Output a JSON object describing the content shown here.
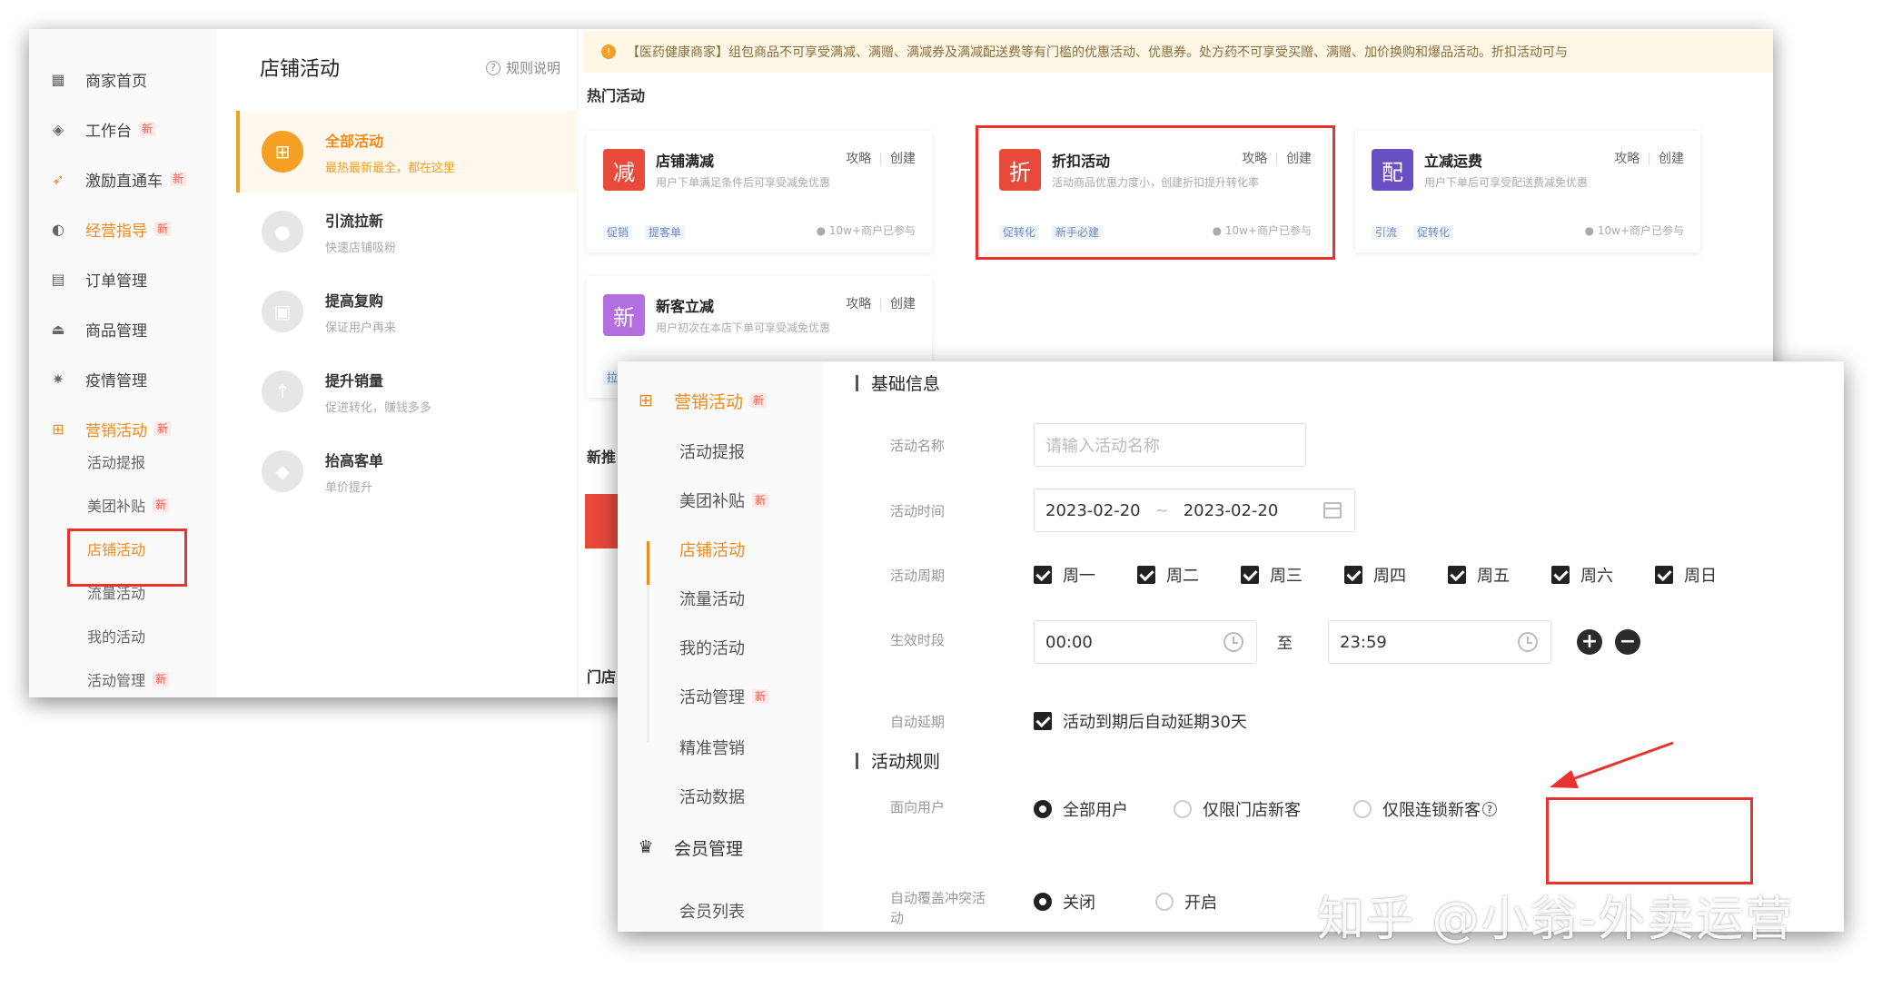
{
  "nav": {
    "items": [
      {
        "label": "商家首页",
        "icon": "grid-icon",
        "new": ""
      },
      {
        "label": "工作台",
        "icon": "cube-icon",
        "new": "新"
      },
      {
        "label": "激励直通车",
        "icon": "rocket-icon",
        "new": "新"
      },
      {
        "label": "经营指导",
        "icon": "pie-chart-icon",
        "new": "新"
      },
      {
        "label": "订单管理",
        "icon": "order-icon",
        "new": ""
      },
      {
        "label": "商品管理",
        "icon": "product-icon",
        "new": ""
      },
      {
        "label": "疫情管理",
        "icon": "virus-icon",
        "new": ""
      },
      {
        "label": "营销活动",
        "icon": "gift-icon",
        "new": "新"
      }
    ],
    "sub": [
      {
        "label": "活动提报",
        "new": ""
      },
      {
        "label": "美团补贴",
        "new": "新"
      },
      {
        "label": "店铺活动",
        "new": ""
      },
      {
        "label": "流量活动",
        "new": ""
      },
      {
        "label": "我的活动",
        "new": ""
      },
      {
        "label": "活动管理",
        "new": "新"
      }
    ]
  },
  "activities": {
    "title": "店铺活动",
    "rules": "规则说明",
    "categories": [
      {
        "title": "全部活动",
        "desc": "最热最新最全，都在这里"
      },
      {
        "title": "引流拉新",
        "desc": "快速店铺吸粉"
      },
      {
        "title": "提高复购",
        "desc": "保证用户再来"
      },
      {
        "title": "提升销量",
        "desc": "促进转化，赚钱多多"
      },
      {
        "title": "抬高客单",
        "desc": "单价提升"
      }
    ]
  },
  "notice": "【医药健康商家】组包商品不可享受满减、满赠、满减券及满减配送费等有门槛的优惠活动、优惠券。处方药不可享受买赠、满赠、加价换购和爆品活动。折扣活动可与",
  "hot": {
    "label": "热门活动",
    "new_label": "新推",
    "store_label": "门店",
    "guide": "攻略",
    "create": "创建",
    "cards": [
      {
        "icon_text": "减",
        "color": "#e84a3c",
        "name": "店铺满减",
        "desc": "用户下单满足条件后可享受减免优惠",
        "tags": [
          "促销",
          "提客单"
        ],
        "joined": "10w+商户已参与"
      },
      {
        "icon_text": "折",
        "color": "#e84a3c",
        "name": "折扣活动",
        "desc": "活动商品优惠力度小，创建折扣提升转化率",
        "tags": [
          "促转化",
          "新手必建"
        ],
        "joined": "10w+商户已参与"
      },
      {
        "icon_text": "配",
        "color": "#6a4fc2",
        "name": "立减运费",
        "desc": "用户下单后可享受配送费减免优惠",
        "tags": [
          "引流",
          "促转化"
        ],
        "joined": "10w+商户已参与"
      },
      {
        "icon_text": "新",
        "color": "#b36ee0",
        "name": "新客立减",
        "desc": "用户初次在本店下单可享受减免优惠",
        "tags": [
          "拉"
        ],
        "joined": ""
      }
    ]
  },
  "front_nav": {
    "groups": [
      {
        "label": "营销活动",
        "new": "新",
        "icon": "gift-icon"
      },
      {
        "label": "会员管理",
        "new": "",
        "icon": "crown-icon"
      }
    ],
    "subs": [
      {
        "label": "活动提报",
        "new": ""
      },
      {
        "label": "美团补贴",
        "new": "新"
      },
      {
        "label": "店铺活动",
        "new": ""
      },
      {
        "label": "流量活动",
        "new": ""
      },
      {
        "label": "我的活动",
        "new": ""
      },
      {
        "label": "活动管理",
        "new": "新"
      },
      {
        "label": "精准营销",
        "new": ""
      },
      {
        "label": "活动数据",
        "new": ""
      },
      {
        "label": "会员列表",
        "new": ""
      }
    ]
  },
  "form": {
    "basic_title": "基础信息",
    "name_label": "活动名称",
    "name_placeholder": "请输入活动名称",
    "time_label": "活动时间",
    "date_start": "2023-02-20",
    "date_sep": "~",
    "date_end": "2023-02-20",
    "cycle_label": "活动周期",
    "days": [
      "周一",
      "周二",
      "周三",
      "周四",
      "周五",
      "周六",
      "周日"
    ],
    "period_label": "生效时段",
    "time_start": "00:00",
    "time_to": "至",
    "time_end": "23:59",
    "add": "+",
    "remove": "−",
    "extend_label": "自动延期",
    "extend_text": "活动到期后自动延期30天",
    "rules_title": "活动规则",
    "target_label": "面向用户",
    "target_options": [
      "全部用户",
      "仅限门店新客",
      "仅限连锁新客"
    ],
    "override_label_1": "自动覆盖冲突活",
    "override_label_2": "动",
    "override_options": [
      "关闭",
      "开启"
    ]
  },
  "watermark": "知乎 @小翁-外卖运营",
  "colors": {
    "accent": "#f08a1d",
    "highlight": "#e8322e",
    "badge": "#ff5a4e"
  }
}
